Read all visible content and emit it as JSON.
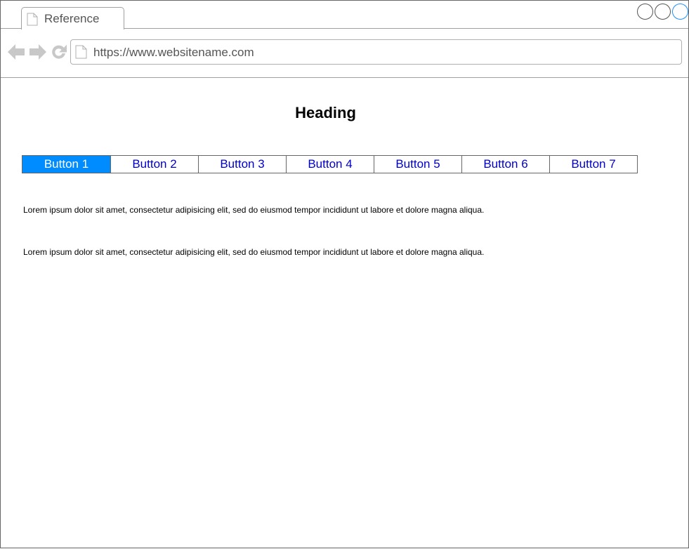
{
  "browser": {
    "tab_title": "Reference",
    "url": "https://www.websitename.com",
    "icons": [
      "document-icon",
      "back-arrow-icon",
      "forward-arrow-icon",
      "reload-icon"
    ],
    "window_controls": [
      "minimize",
      "maximize",
      "close"
    ]
  },
  "page": {
    "heading": "Heading",
    "buttons": [
      {
        "label": "Button 1",
        "active": true
      },
      {
        "label": "Button 2",
        "active": false
      },
      {
        "label": "Button 3",
        "active": false
      },
      {
        "label": "Button 4",
        "active": false
      },
      {
        "label": "Button 5",
        "active": false
      },
      {
        "label": "Button 6",
        "active": false
      },
      {
        "label": "Button 7",
        "active": false
      }
    ],
    "paragraphs": [
      "Lorem ipsum dolor sit amet, consectetur adipisicing elit, sed do eiusmod tempor incididunt ut labore et dolore magna aliqua.",
      "Lorem ipsum dolor sit amet, consectetur adipisicing elit, sed do eiusmod tempor incididunt ut labore et dolore magna aliqua."
    ]
  },
  "colors": {
    "active_button_bg": "#008cff",
    "button_text": "#0000cc",
    "close_control": "#1e90ff"
  }
}
